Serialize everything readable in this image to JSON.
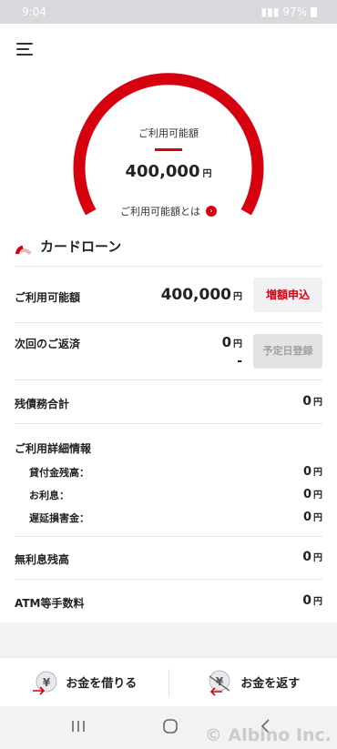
{
  "status_bar": {
    "time": "9:04",
    "battery": "97%"
  },
  "gauge": {
    "label": "ご利用可能額",
    "amount": "400,000",
    "unit": "円",
    "link_text": "ご利用可能額とは",
    "fill_fraction": 1.0,
    "color": "#d7000f"
  },
  "section": {
    "title": "カードローン"
  },
  "rows": {
    "available": {
      "label": "ご利用可能額",
      "value": "400,000",
      "unit": "円",
      "button": "増額申込"
    },
    "next_repayment": {
      "label": "次回のご返済",
      "value": "0",
      "unit": "円",
      "date": "-",
      "button": "予定日登録"
    },
    "total_debt": {
      "label": "残債務合計",
      "value": "0",
      "unit": "円"
    },
    "details": {
      "label": "ご利用詳細情報",
      "items": [
        {
          "label": "貸付金残高：",
          "value": "0",
          "unit": "円"
        },
        {
          "label": "お利息：",
          "value": "0",
          "unit": "円"
        },
        {
          "label": "遅延損害金：",
          "value": "0",
          "unit": "円"
        }
      ]
    },
    "interest_free": {
      "label": "無利息残高",
      "value": "0",
      "unit": "円"
    },
    "atm_fee": {
      "label": "ATM等手数料",
      "value": "0",
      "unit": "円"
    }
  },
  "actions": {
    "borrow": "お金を借りる",
    "repay": "お金を返す"
  },
  "watermark": "© Albino Inc.",
  "colors": {
    "accent": "#d7000f",
    "background": "#f2f2f4"
  }
}
